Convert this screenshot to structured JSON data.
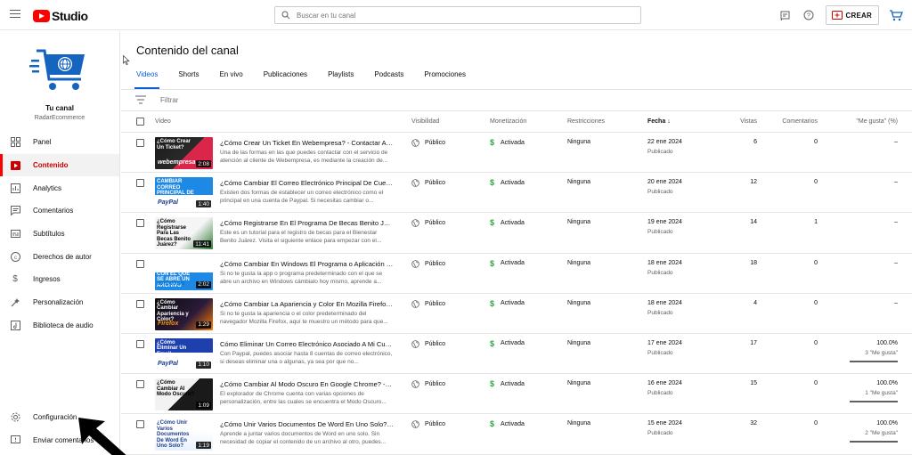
{
  "header": {
    "logo_text": "Studio",
    "search_placeholder": "Buscar en tu canal",
    "create_label": "CREAR"
  },
  "channel": {
    "name": "Tu canal",
    "handle": "RadarEcommerce"
  },
  "sidebar": {
    "items": [
      {
        "label": "Panel",
        "icon": "dashboard-icon"
      },
      {
        "label": "Contenido",
        "icon": "content-icon",
        "active": true
      },
      {
        "label": "Analytics",
        "icon": "analytics-icon"
      },
      {
        "label": "Comentarios",
        "icon": "comments-icon"
      },
      {
        "label": "Subtítulos",
        "icon": "subtitles-icon"
      },
      {
        "label": "Derechos de autor",
        "icon": "copyright-icon"
      },
      {
        "label": "Ingresos",
        "icon": "dollar-icon"
      },
      {
        "label": "Personalización",
        "icon": "customization-icon"
      },
      {
        "label": "Biblioteca de audio",
        "icon": "audio-library-icon"
      }
    ],
    "bottom_items": [
      {
        "label": "Configuración",
        "icon": "gear-icon"
      },
      {
        "label": "Enviar comentarios",
        "icon": "feedback-icon"
      }
    ]
  },
  "main": {
    "title": "Contenido del canal",
    "tabs": [
      "Videos",
      "Shorts",
      "En vivo",
      "Publicaciones",
      "Playlists",
      "Podcasts",
      "Promociones"
    ],
    "active_tab": "Videos",
    "filter_placeholder": "Filtrar",
    "columns": {
      "video": "Video",
      "visibility": "Visibilidad",
      "monetization": "Monetización",
      "restrictions": "Restricciones",
      "date": "Fecha",
      "views": "Vistas",
      "comments": "Comentarios",
      "likes": "\"Me gusta\" (%)"
    },
    "rows": [
      {
        "title": "¿Cómo Crear Un Ticket En Webempresa? - Contactar Atenció...",
        "desc": "Una de las formas en las que puedes contactar con el servicio de atención al cliente de Webempresa, es mediante la creación de...",
        "thumb_text": "¿Cómo Crear Un Ticket?",
        "thumb_brand": "webempresa",
        "duration": "2:08",
        "visibility": "Público",
        "monetization": "Activada",
        "restrictions": "Ninguna",
        "date": "22 ene 2024",
        "status": "Publicado",
        "views": "6",
        "comments": "0",
        "likes": "–",
        "likes_sub": "",
        "likes_pct": null
      },
      {
        "title": "¿Cómo Cambiar El Correo Electrónico Principal De Cuenta P...",
        "desc": "Existen dos formas de establecer un correo electrónico como el principal en una cuenta de Paypal. Si necesitas cambiar o...",
        "thumb_text": "CAMBIAR CORREO PRINCIPAL DE",
        "thumb_brand": "PayPal",
        "duration": "1:40",
        "visibility": "Público",
        "monetization": "Activada",
        "restrictions": "Ninguna",
        "date": "20 ene 2024",
        "status": "Publicado",
        "views": "12",
        "comments": "0",
        "likes": "–",
        "likes_sub": "",
        "likes_pct": null
      },
      {
        "title": "¿Cómo Registrarse En El Programa De Becas Benito Juárez?...",
        "desc": "Este es un tutorial para el registro de becas para el Bienestar Benito Juárez. Visita el siguiente enlace para empezar con el...",
        "thumb_text": "¿Cómo Registrarse Para Las Becas Benito Juárez?",
        "thumb_brand": "",
        "duration": "11:41",
        "visibility": "Público",
        "monetization": "Activada",
        "restrictions": "Ninguna",
        "date": "19 ene 2024",
        "status": "Publicado",
        "views": "14",
        "comments": "1",
        "likes": "–",
        "likes_sub": "",
        "likes_pct": null
      },
      {
        "title": "¿Cómo Cambiar En Windows El Programa o Aplicación Con ...",
        "desc": "Si no te gusta la app o programa predeterminado con el que se abre un archivo en Windows cámbialo hoy mismo, aprende a...",
        "thumb_text": "CAMBIAR EL PROGRAMA CON EL QUE SE ABRE UN ARCHIVO",
        "thumb_brand": "Windows",
        "duration": "2:02",
        "visibility": "Público",
        "monetization": "Activada",
        "restrictions": "Ninguna",
        "date": "18 ene 2024",
        "status": "Publicado",
        "views": "18",
        "comments": "0",
        "likes": "–",
        "likes_sub": "",
        "likes_pct": null
      },
      {
        "title": "¿Cómo Cambiar La Apariencia y Color En Mozilla Firefox? -...",
        "desc": "Si no te gusta la apariencia o el color predeterminado del navegador Mozilla Firefox, aquí te muestro un método para que...",
        "thumb_text": "¿Cómo Cambiar Apariencia y Color?",
        "thumb_brand": "Firefox",
        "duration": "1:29",
        "visibility": "Público",
        "monetization": "Activada",
        "restrictions": "Ninguna",
        "date": "18 ene 2024",
        "status": "Publicado",
        "views": "4",
        "comments": "0",
        "likes": "–",
        "likes_sub": "",
        "likes_pct": null
      },
      {
        "title": "Cómo Eliminar Un Correo Electrónico Asociado A Mi Cuenta ...",
        "desc": "Con Paypal, puedes asociar hasta 8 cuentas de correo electrónico, si deseas eliminar una o algunas, ya sea por que no...",
        "thumb_text": "¿Cómo Eliminar Un Email Asociado A MI Cuenta?",
        "thumb_brand": "PayPal",
        "duration": "1:10",
        "visibility": "Público",
        "monetization": "Activada",
        "restrictions": "Ninguna",
        "date": "17 ene 2024",
        "status": "Publicado",
        "views": "17",
        "comments": "0",
        "likes": "100.0%",
        "likes_sub": "3 \"Me gusta\"",
        "likes_pct": 100
      },
      {
        "title": "¿Cómo Cambiar Al Modo Oscuro En Google Chrome? - Selec...",
        "desc": "El explorador de Chrome cuenta con varias opciones de personalización, entre las cuales se encuentra el Modo Oscuro...",
        "thumb_text": "¿Cómo Cambiar Al Modo Oscuro?",
        "thumb_brand": "",
        "duration": "1:09",
        "visibility": "Público",
        "monetization": "Activada",
        "restrictions": "Ninguna",
        "date": "16 ene 2024",
        "status": "Publicado",
        "views": "15",
        "comments": "0",
        "likes": "100.0%",
        "likes_sub": "1 \"Me gusta\"",
        "likes_pct": 100
      },
      {
        "title": "¿Cómo Unir Varios Documentos De Word En Uno Solo? - Fusi...",
        "desc": "Aprende a juntar varios documentos de Word en uno solo. Sin necesidad de copiar el contenido de un archivo al otro, puedes...",
        "thumb_text": "¿Cómo Unir Varios Documentos De Word En Uno Solo?",
        "thumb_brand": "",
        "duration": "1:19",
        "visibility": "Público",
        "monetization": "Activada",
        "restrictions": "Ninguna",
        "date": "15 ene 2024",
        "status": "Publicado",
        "views": "32",
        "comments": "0",
        "likes": "100.0%",
        "likes_sub": "2 \"Me gusta\"",
        "likes_pct": 100
      }
    ]
  },
  "colors": {
    "brand_red": "#ff0000",
    "accent_blue": "#065fd4",
    "monetization_green": "#2ba640"
  }
}
